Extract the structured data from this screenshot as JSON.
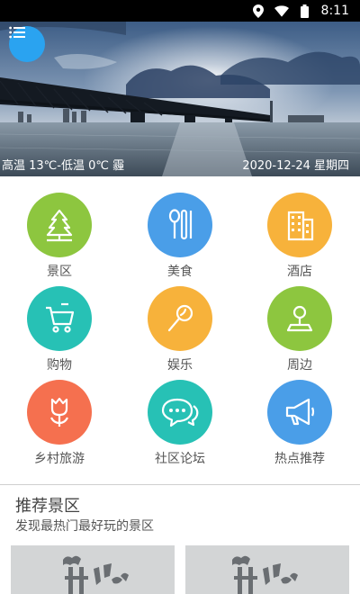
{
  "status_bar": {
    "time": "8:11",
    "icons": [
      "location-icon",
      "wifi-icon",
      "battery-icon"
    ]
  },
  "banner": {
    "weather": "高温 13℃-低温 0℃ 霾",
    "date": "2020-12-24 星期四",
    "menu_icon": "list-menu-icon"
  },
  "categories": [
    {
      "label": "景区",
      "icon": "tree-icon",
      "color": "#8dc63f"
    },
    {
      "label": "美食",
      "icon": "spoon-fork-icon",
      "color": "#4a9ee8"
    },
    {
      "label": "酒店",
      "icon": "hotel-icon",
      "color": "#f7b23b"
    },
    {
      "label": "购物",
      "icon": "cart-icon",
      "color": "#27c1b5"
    },
    {
      "label": "娱乐",
      "icon": "microphone-icon",
      "color": "#f7b23b"
    },
    {
      "label": "周边",
      "icon": "map-pin-icon",
      "color": "#8dc63f"
    },
    {
      "label": "乡村旅游",
      "icon": "tulip-icon",
      "color": "#f5704f"
    },
    {
      "label": "社区论坛",
      "icon": "chat-icon",
      "color": "#27c1b5"
    },
    {
      "label": "热点推荐",
      "icon": "megaphone-icon",
      "color": "#4a9ee8"
    }
  ],
  "recommend": {
    "title": "推荐景区",
    "subtitle": "发现最热门最好玩的景区"
  }
}
